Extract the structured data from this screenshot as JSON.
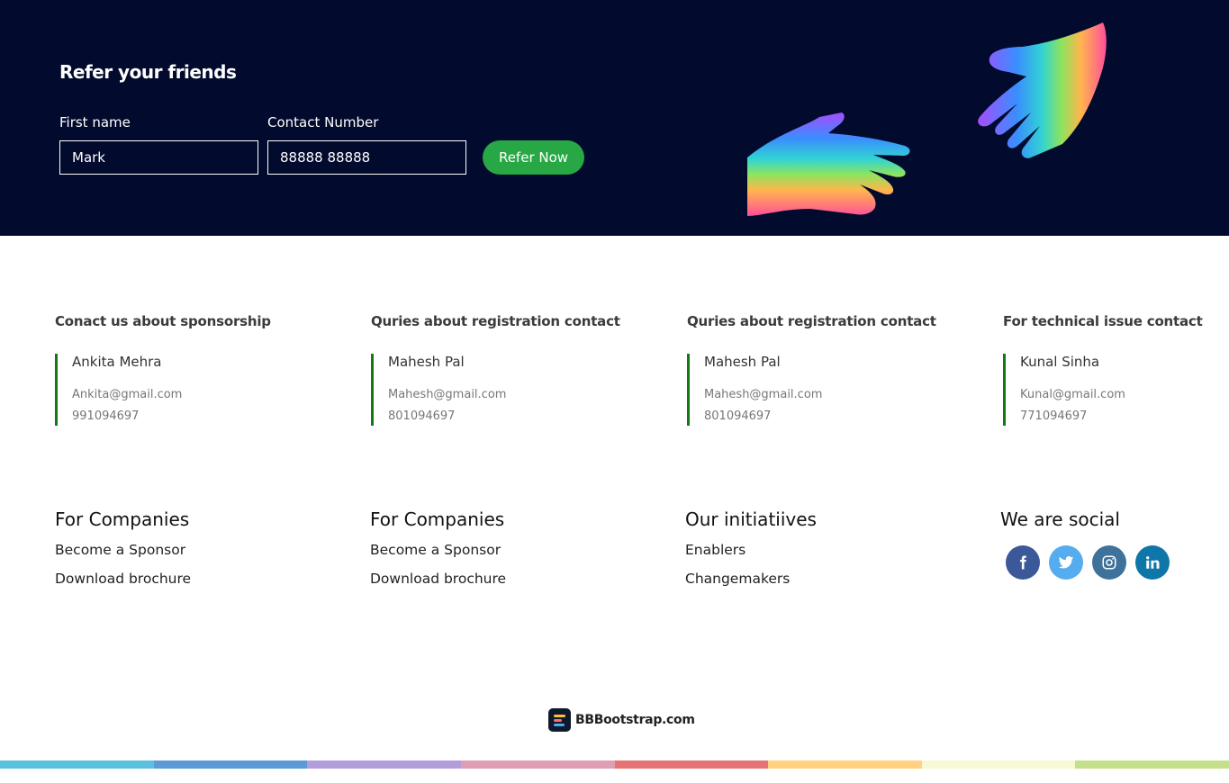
{
  "refer": {
    "title": "Refer your friends",
    "first_name_label": "First name",
    "first_name_value": "Mark",
    "contact_label": "Contact Number",
    "contact_value": "88888 88888",
    "button_label": "Refer Now"
  },
  "contacts": [
    {
      "heading": "Conact us about sponsorship",
      "name": "Ankita Mehra",
      "email": "Ankita@gmail.com",
      "phone": "991094697"
    },
    {
      "heading": "Quries about registration contact",
      "name": "Mahesh Pal",
      "email": "Mahesh@gmail.com",
      "phone": "801094697"
    },
    {
      "heading": "Quries about registration contact",
      "name": "Mahesh Pal",
      "email": "Mahesh@gmail.com",
      "phone": "801094697"
    },
    {
      "heading": "For technical issue contact",
      "name": "Kunal Sinha",
      "email": "Kunal@gmail.com",
      "phone": "771094697"
    }
  ],
  "footer_columns": [
    {
      "heading": "For Companies",
      "links": [
        "Become a Sponsor",
        "Download brochure"
      ]
    },
    {
      "heading": "For Companies",
      "links": [
        "Become a Sponsor",
        "Download brochure"
      ]
    },
    {
      "heading": "Our initiatiives",
      "links": [
        "Enablers",
        "Changemakers"
      ]
    }
  ],
  "social": {
    "heading": "We are social",
    "icons": [
      {
        "name": "facebook-icon",
        "color": "#3b5998"
      },
      {
        "name": "twitter-icon",
        "color": "#55acee"
      },
      {
        "name": "instagram-icon",
        "color": "#3f729b"
      },
      {
        "name": "linkedin-icon",
        "color": "#0e76a8"
      }
    ]
  },
  "brand": {
    "text": "BBBootstrap.com",
    "icon": "bbbootstrap-logo-icon"
  },
  "colors": {
    "banner_bg": "#020b2d",
    "button_green": "#28a745",
    "accent_border": "#137a13",
    "stripe": [
      "#5bc0de",
      "#5a9bd5",
      "#b39ddb",
      "#de9fb5",
      "#e57373",
      "#ffd180",
      "#f6f9d2",
      "#c5e08a"
    ]
  }
}
